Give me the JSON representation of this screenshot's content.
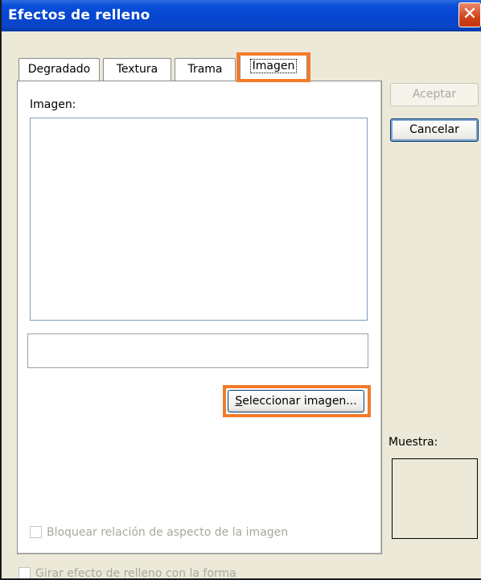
{
  "window": {
    "title": "Efectos de relleno",
    "close_glyph": "✕",
    "colors": {
      "titlebar": "#0646d2",
      "face": "#ece9d8",
      "highlight": "#f47b2a"
    }
  },
  "tabs": [
    {
      "label": "Degradado",
      "active": false
    },
    {
      "label": "Textura",
      "active": false
    },
    {
      "label": "Trama",
      "active": false
    },
    {
      "label": "Imagen",
      "active": true
    }
  ],
  "panel": {
    "image_label": "Imagen:",
    "select_button": {
      "pre": "",
      "mnemonic": "S",
      "post": "eleccionar imagen..."
    },
    "lock_aspect": {
      "label": "Bloquear relación de aspecto de la imagen",
      "checked": false,
      "enabled": false
    }
  },
  "rotate_with_shape": {
    "label": "Girar efecto de relleno con la forma",
    "checked": false,
    "enabled": false
  },
  "buttons": {
    "accept": "Aceptar",
    "cancel": "Cancelar"
  },
  "preview": {
    "label": "Muestra:"
  }
}
